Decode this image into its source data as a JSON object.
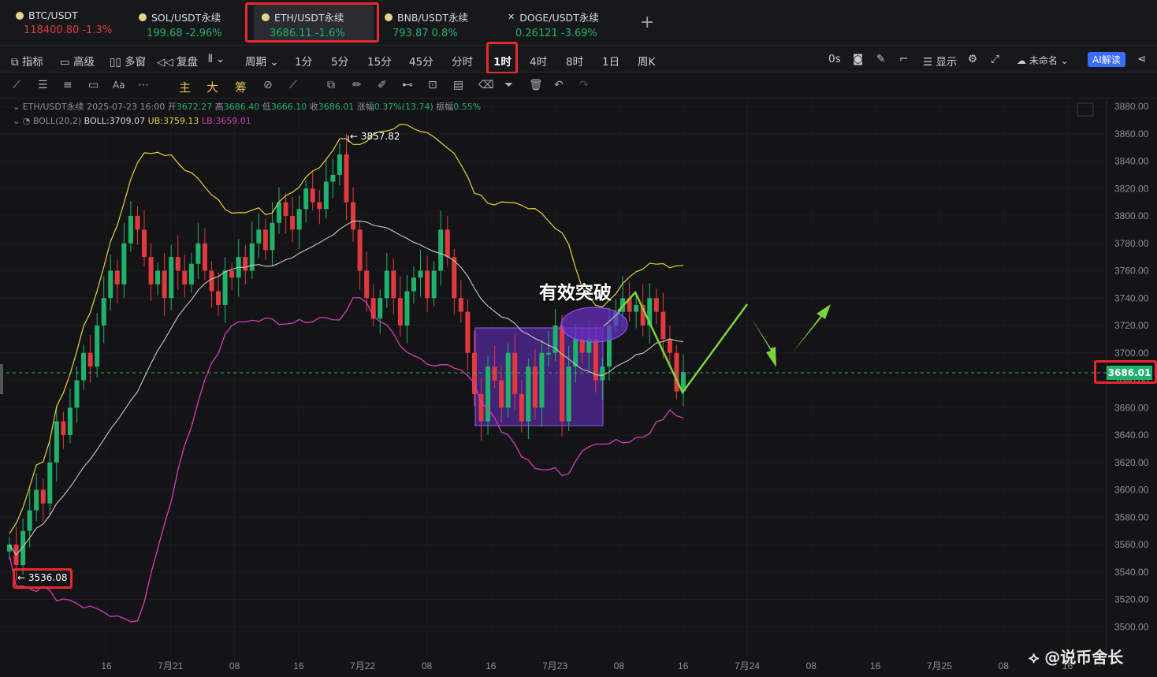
{
  "tabs": [
    {
      "name": "BTC/USDT",
      "price": "118400.80",
      "change": "-1.3%",
      "trend": "down"
    },
    {
      "name": "SOL/USDT永续",
      "price": "199.68",
      "change": "-2.96%",
      "trend": "up"
    },
    {
      "name": "ETH/USDT永续",
      "price": "3686.11",
      "change": "-1.6%",
      "trend": "up"
    },
    {
      "name": "BNB/USDT永续",
      "price": "793.87",
      "change": "0.8%",
      "trend": "up"
    },
    {
      "name": "DOGE/USDT永续",
      "price": "0.26121",
      "change": "-3.69%",
      "trend": "up"
    }
  ],
  "add_tab": "+",
  "toolbar": {
    "indicators": "指标",
    "advanced": "高级",
    "multi": "多窗",
    "replay": "复盘",
    "period": "周期",
    "intervals": [
      "1分",
      "5分",
      "15分",
      "45分",
      "分时",
      "1时",
      "4时",
      "8时",
      "1日",
      "周K"
    ],
    "selected_interval": "1时",
    "countdown": "0s",
    "display": "显示",
    "layout_name": "未命名",
    "ai": "AI解读"
  },
  "drawing_tools": {
    "main": "主",
    "big": "大",
    "chips": "筹",
    "text": "Aa"
  },
  "legend": {
    "symbol": "ETH/USDT永续",
    "time": "2025-07-23 16:00",
    "open_label": "开",
    "open": "3672.27",
    "high_label": "高",
    "high": "3686.40",
    "low_label": "低",
    "low": "3666.10",
    "close_label": "收",
    "close": "3686.01",
    "change_label": "涨幅",
    "change": "0.37%(13.74)",
    "amp_label": "振幅",
    "amp": "0.55%",
    "boll": "BOLL(20,2)",
    "boll_mid": "BOLL:3709.07",
    "boll_ub": "UB:3759.13",
    "boll_lb": "LB:3659.01"
  },
  "annotation": "有效突破",
  "current_price": "3686.01",
  "high_marker": "3857.82",
  "low_marker": "3536.08",
  "watermark": "@说币舍长",
  "y_axis": [
    "3880.00",
    "3860.00",
    "3840.00",
    "3820.00",
    "3800.00",
    "3780.00",
    "3760.00",
    "3740.00",
    "3720.00",
    "3700.00",
    "3680.00",
    "3660.00",
    "3640.00",
    "3620.00",
    "3600.00",
    "3580.00",
    "3560.00",
    "3540.00",
    "3520.00",
    "3500.00"
  ],
  "x_axis": [
    "16",
    "7月21",
    "08",
    "16",
    "7月22",
    "08",
    "16",
    "7月23",
    "08",
    "16",
    "7月24",
    "08",
    "16",
    "7月25",
    "08",
    "16"
  ],
  "colors": {
    "up": "#20b26c",
    "down": "#e0393e",
    "ub": "#e6d23a",
    "mid": "#c8c8c8",
    "lb": "#d63bb8",
    "box": "#7b3bd6",
    "arrow": "#7fd43a",
    "hl": "#e8282d"
  }
}
